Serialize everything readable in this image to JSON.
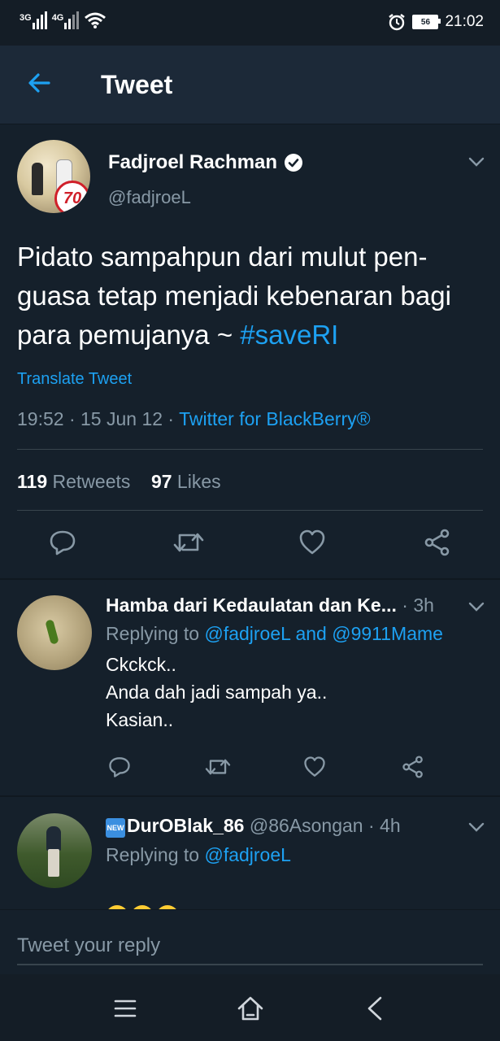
{
  "status_bar": {
    "network1": "3G",
    "network2": "4G",
    "time": "21:02",
    "battery": "56"
  },
  "header": {
    "title": "Tweet"
  },
  "tweet": {
    "author_name": "Fadjroel Rachman",
    "author_handle": "@fadjroeL",
    "avatar_badge": "70",
    "text": "Pidato sampahpun dari mulut pen-guasa tetap menjadi kebenaran bagi para pemujanya ~ ",
    "hashtag": "#saveRI",
    "translate": "Translate Tweet",
    "time": "19:52",
    "date": "15 Jun 12",
    "source": "Twitter for BlackBerry®",
    "retweets_count": "119",
    "retweets_label": "Retweets",
    "likes_count": "97",
    "likes_label": "Likes"
  },
  "replies": [
    {
      "name": "Hamba dari Kedaulatan dan Ke...",
      "time": "3h",
      "replying_prefix": "Replying to ",
      "replying_to": "@fadjroeL and @9911Mame",
      "text": "Ckckck..\nAnda dah jadi sampah ya..\nKasian.."
    },
    {
      "badge": "NEW",
      "name": "DurOBlak_86",
      "handle": "@86Asongan",
      "time": "4h",
      "replying_prefix": "Replying to ",
      "replying_to": "@fadjroeL"
    }
  ],
  "reply_box": {
    "placeholder": "Tweet your reply"
  },
  "icons": {
    "back": "arrow-left-icon",
    "verified": "verified-badge-icon",
    "more": "chevron-down-icon",
    "reply": "reply-icon",
    "retweet": "retweet-icon",
    "like": "heart-icon",
    "share": "share-icon",
    "menu": "menu-icon",
    "home": "home-icon",
    "back_nav": "back-nav-icon"
  },
  "colors": {
    "background": "#15202b",
    "accent": "#1da1f2",
    "secondary_text": "#8899a6",
    "appbar": "#1c2938"
  }
}
